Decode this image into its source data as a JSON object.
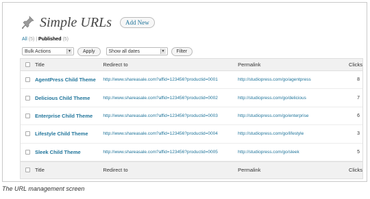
{
  "header": {
    "title": "Simple URLs",
    "add_new_label": "Add New"
  },
  "filters": {
    "all_label": "All",
    "all_count": "(5)",
    "separator": "|",
    "published_label": "Published",
    "published_count": "(5)"
  },
  "tablenav": {
    "bulk_actions": "Bulk Actions",
    "apply_label": "Apply",
    "dates": "Show all dates",
    "filter_label": "Filter"
  },
  "columns": {
    "title": "Title",
    "redirect": "Redirect to",
    "permalink": "Permalink",
    "clicks": "Clicks"
  },
  "rows": [
    {
      "title": "AgentPress Child Theme",
      "redirect": "http://www.shareasale.com?affid=123456?productid=0001",
      "permalink": "http://studiopress.com/go/agentpress",
      "clicks": "8"
    },
    {
      "title": "Delicious Child Theme",
      "redirect": "http://www.shareasale.com?affid=123456?productid=0002",
      "permalink": "http://studiopress.com/go/delicious",
      "clicks": "7"
    },
    {
      "title": "Enterprise Child Theme",
      "redirect": "http://www.shareasale.com?affid=123456?productid=0003",
      "permalink": "http://studiopress.com/go/enterprise",
      "clicks": "6"
    },
    {
      "title": "Lifestyle Child Theme",
      "redirect": "http://www.shareasale.com?affid=123456?productid=0004",
      "permalink": "http://studiopress.com/go/lifestyle",
      "clicks": "3"
    },
    {
      "title": "Sleek Child Theme",
      "redirect": "http://www.shareasale.com?affid=123456?productid=0005",
      "permalink": "http://studiopress.com/go/sleek",
      "clicks": "5"
    }
  ],
  "caption": "The URL management screen"
}
